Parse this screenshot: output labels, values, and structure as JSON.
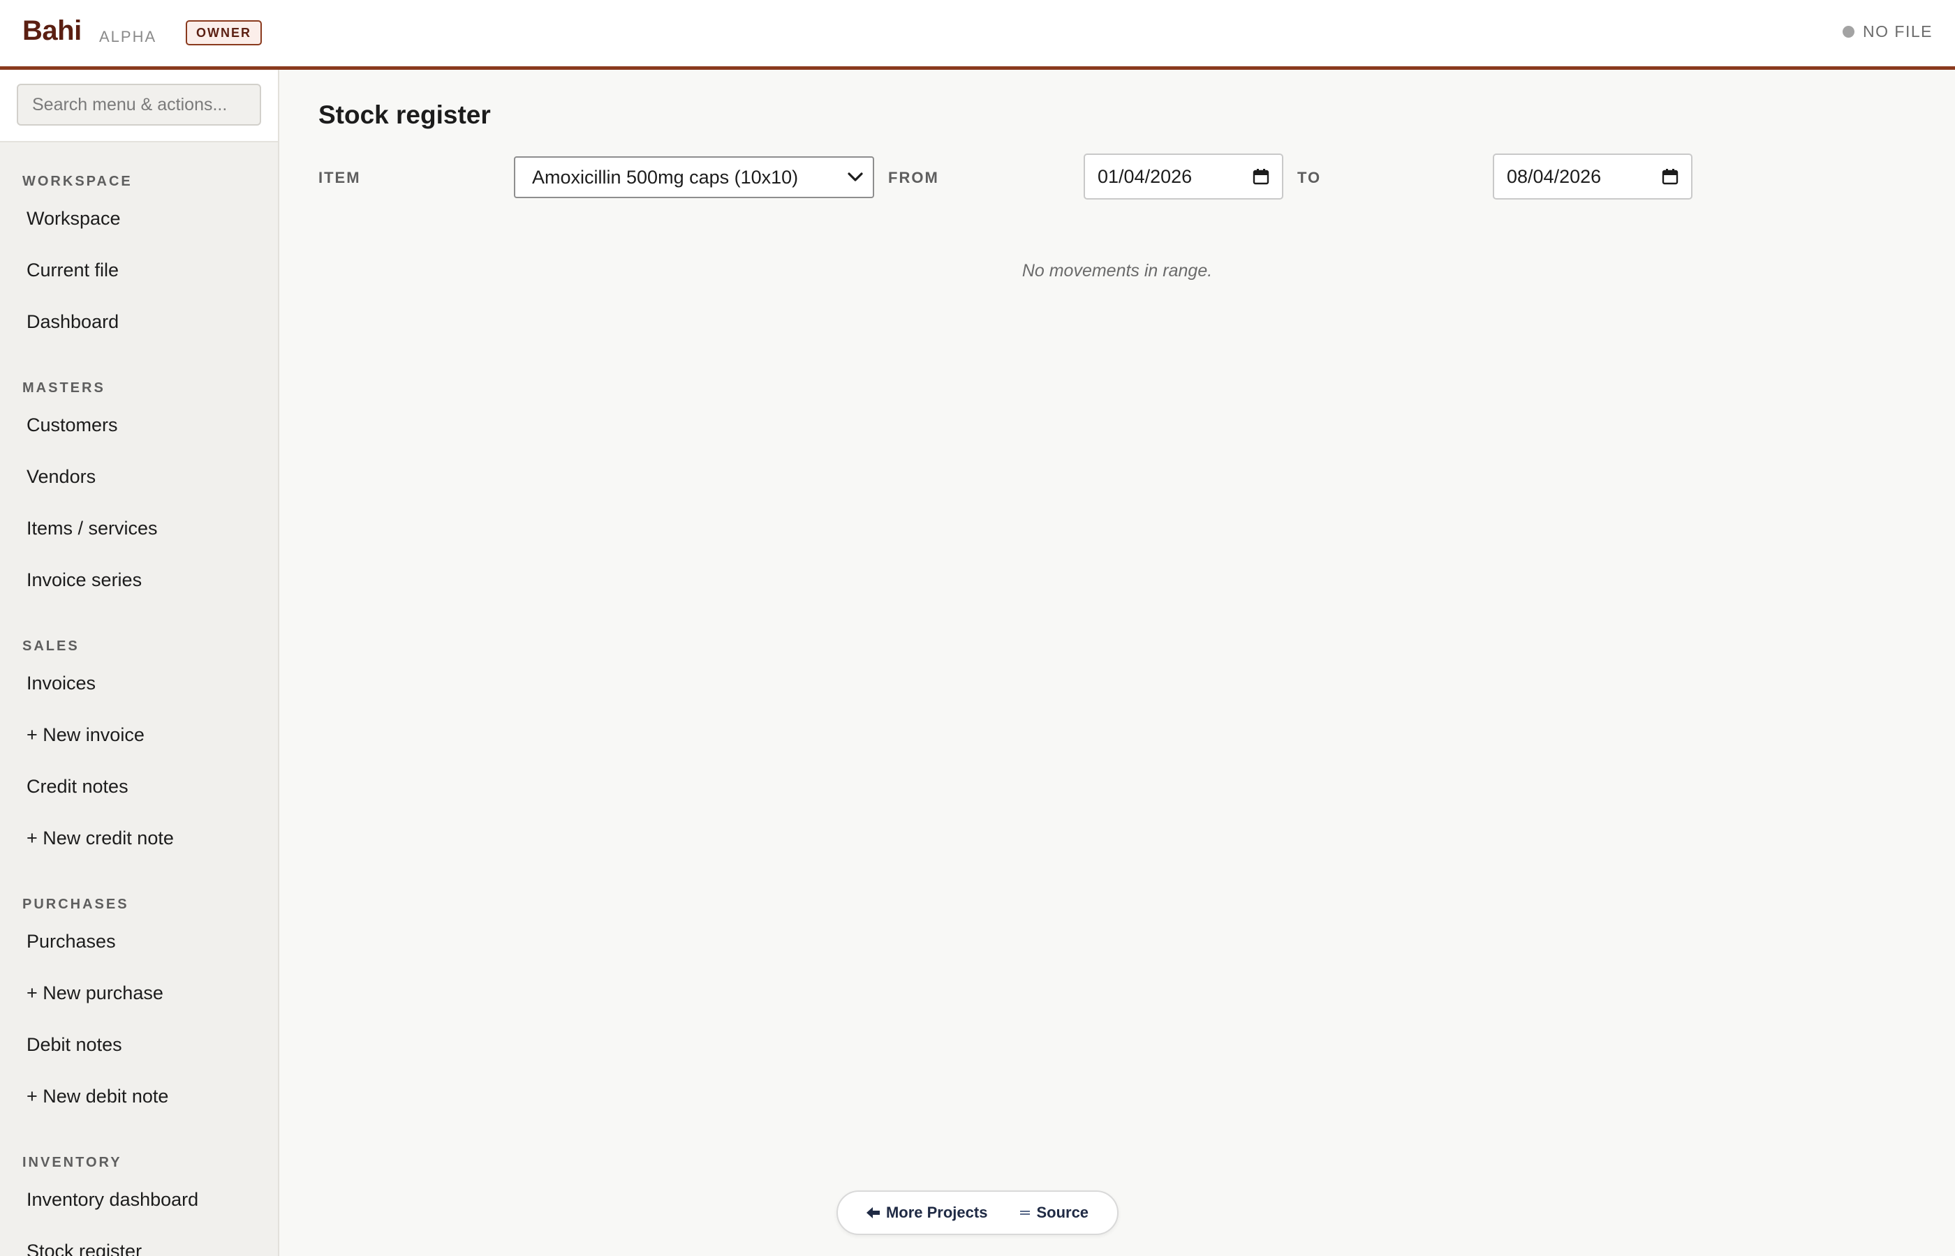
{
  "header": {
    "brand": "Bahi",
    "tag": "ALPHA",
    "role_badge": "OWNER",
    "file_status": "NO FILE"
  },
  "sidebar": {
    "search_placeholder": "Search menu & actions...",
    "sections": [
      {
        "title": "WORKSPACE",
        "items": [
          "Workspace",
          "Current file",
          "Dashboard"
        ]
      },
      {
        "title": "MASTERS",
        "items": [
          "Customers",
          "Vendors",
          "Items / services",
          "Invoice series"
        ]
      },
      {
        "title": "SALES",
        "items": [
          "Invoices",
          "+ New invoice",
          "Credit notes",
          "+ New credit note"
        ]
      },
      {
        "title": "PURCHASES",
        "items": [
          "Purchases",
          "+ New purchase",
          "Debit notes",
          "+ New debit note"
        ]
      },
      {
        "title": "INVENTORY",
        "items": [
          "Inventory dashboard",
          "Stock register"
        ]
      }
    ]
  },
  "main": {
    "title": "Stock register",
    "filters": {
      "item_label": "ITEM",
      "item_value": "Amoxicillin 500mg caps (10x10)",
      "from_label": "FROM",
      "from_value": "01/04/2026",
      "to_label": "TO",
      "to_value": "08/04/2026"
    },
    "empty_message": "No movements in range."
  },
  "footer": {
    "more_projects": "More Projects",
    "source": "Source"
  },
  "colors": {
    "brand": "#5b1f12",
    "accent": "#8a3a1e",
    "sidebar_bg": "#f1f0ed",
    "main_bg": "#f8f8f6"
  },
  "icons": {
    "select_arrow": "chevron-down-icon",
    "date_picker": "calendar-icon",
    "status": "status-dot-icon",
    "more_projects": "arrow-left-icon",
    "source": "code-icon"
  }
}
